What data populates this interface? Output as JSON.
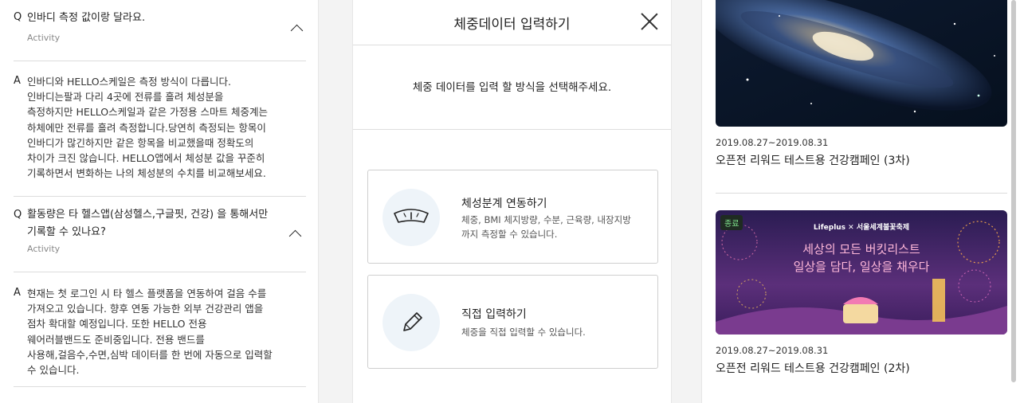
{
  "faq": {
    "q_mark": "Q",
    "a_mark": "A",
    "items": [
      {
        "question_lines": [
          "인바디 측정 값이랑 달라요."
        ],
        "category": "Activity",
        "answer_lines": [
          "인바디와 HELLO스케일은 측정 방식이 다릅니다.",
          "인바디는팔과 다리 4곳에 전류를 흘려 체성분을",
          "측정하지만 HELLO스케일과 같은 가정용 스마트 체중계는",
          "하체에만 전류를 흘려 측정합니다.당연히 측정되는 항목이",
          "인바디가 많긴하지만 같은 항목을 비교했을때 정확도의",
          "차이가 크진 않습니다. HELLO앱에서 체성분 값을 꾸준히",
          "기록하면서 변화하는 나의 체성분의 수치를 비교해보세요."
        ]
      },
      {
        "question_lines": [
          "활동량은 타 헬스앱(삼성헬스,구글핏, 건강) 을 통해서만",
          "기록할 수 있나요?"
        ],
        "category": "Activity",
        "answer_lines": [
          "현재는 첫 로그인 시 타 헬스 플랫폼을 연동하여 걸음 수를",
          "가져오고 있습니다. 향후 연동 가능한 외부 건강관리 앱을",
          "점차 확대할 예정입니다. 또한 HELLO 전용",
          "웨어러블밴드도 준비중입니다. 전용 밴드를",
          "사용해,걸음수,수면,심박 데이터를 한 번에 자동으로 입력할",
          "수 있습니다."
        ]
      }
    ]
  },
  "modal": {
    "title": "체중데이터 입력하기",
    "instruction": "체중 데이터를 입력 할 방식을 선택해주세요.",
    "options": [
      {
        "title": "체성분계 연동하기",
        "desc_lines": [
          "체중, BMI 체지방량, 수분, 근육량, 내장지방",
          "까지 측정할 수 있습니다."
        ],
        "icon": "scale-icon"
      },
      {
        "title": "직접 입력하기",
        "desc_lines": [
          "체중을 직접 입력할 수 있습니다."
        ],
        "icon": "pencil-icon"
      }
    ]
  },
  "campaigns": {
    "items": [
      {
        "date": "2019.08.27~2019.08.31",
        "title": "오픈전 리워드 테스트용 건강캠페인 (3차)",
        "image": "galaxy-image"
      },
      {
        "date": "2019.08.27~2019.08.31",
        "title": "오픈전 리워드 테스트용 건강캠페인 (2차)",
        "image": "festival-banner-image",
        "badge": "종료",
        "banner_brand": "Lifeplus ✕ 서울세계불꽃축제",
        "banner_line1": "세상의 모든 버킷리스트",
        "banner_line2": "일상을 담다, 일상을 채우다"
      }
    ]
  },
  "colors": {
    "accent_icon_bg": "#eef4f9",
    "badge_bg": "#1f2b22",
    "badge_text": "#7dde8a"
  }
}
